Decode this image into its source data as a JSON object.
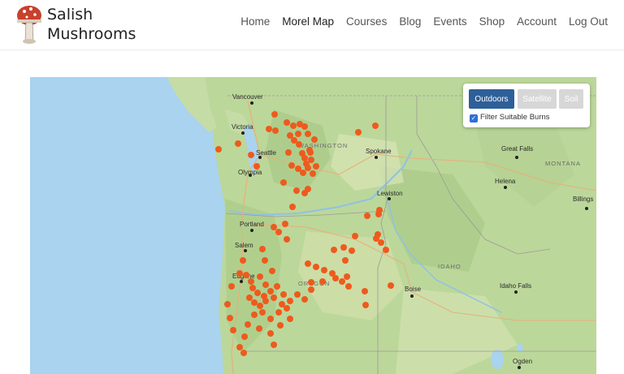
{
  "brand": {
    "line1": "Salish",
    "line2": "Mushrooms"
  },
  "nav": [
    "Home",
    "Morel Map",
    "Courses",
    "Blog",
    "Events",
    "Shop",
    "Account",
    "Log Out"
  ],
  "nav_active": "Morel Map",
  "map_controls": {
    "layers": [
      "Outdoors",
      "Satellite",
      "Soil"
    ],
    "active_layer": "Outdoors",
    "filter_label": "Filter Suitable Burns",
    "filter_checked": true
  },
  "map_labels": {
    "cities": [
      "Vancouver",
      "Victoria",
      "Seattle",
      "Olympia",
      "Portland",
      "Salem",
      "Eugene",
      "Spokane",
      "Lewiston",
      "Boise",
      "Great Falls",
      "Helena",
      "Billings",
      "Idaho Falls",
      "Ogden"
    ],
    "states": [
      "WASHINGTON",
      "OREGON",
      "IDAHO",
      "MONTANA"
    ]
  },
  "colors": {
    "marker": "#ee5a1e",
    "brand_blue": "#2e5f99",
    "water": "#a9d3ef",
    "land": "#bcd79a"
  }
}
